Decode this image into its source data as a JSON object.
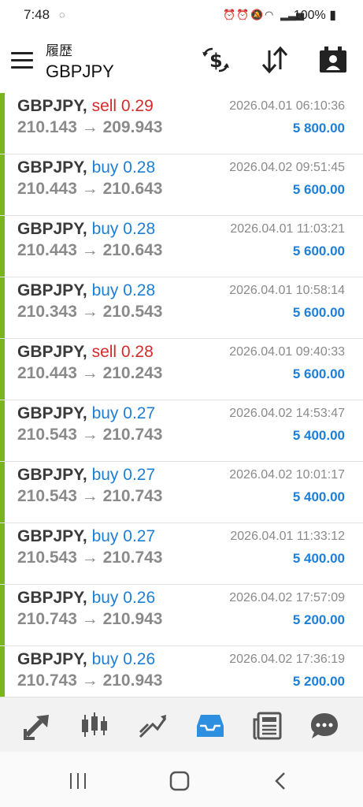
{
  "status_bar": {
    "time": "7:48",
    "battery": "100%"
  },
  "header": {
    "subtitle": "履歴",
    "symbol": "GBPJPY"
  },
  "trades": [
    {
      "symbol": "GBPJPY,",
      "side": "sell",
      "lots": "0.29",
      "prices": "210.143 → 209.943",
      "datetime": "2026.04.01 06:10:36",
      "profit": "5 800.00"
    },
    {
      "symbol": "GBPJPY,",
      "side": "buy",
      "lots": "0.28",
      "prices": "210.443 → 210.643",
      "datetime": "2026.04.02 09:51:45",
      "profit": "5 600.00"
    },
    {
      "symbol": "GBPJPY,",
      "side": "buy",
      "lots": "0.28",
      "prices": "210.443 → 210.643",
      "datetime": "2026.04.01 11:03:21",
      "profit": "5 600.00"
    },
    {
      "symbol": "GBPJPY,",
      "side": "buy",
      "lots": "0.28",
      "prices": "210.343 → 210.543",
      "datetime": "2026.04.01 10:58:14",
      "profit": "5 600.00"
    },
    {
      "symbol": "GBPJPY,",
      "side": "sell",
      "lots": "0.28",
      "prices": "210.443 → 210.243",
      "datetime": "2026.04.01 09:40:33",
      "profit": "5 600.00"
    },
    {
      "symbol": "GBPJPY,",
      "side": "buy",
      "lots": "0.27",
      "prices": "210.543 → 210.743",
      "datetime": "2026.04.02 14:53:47",
      "profit": "5 400.00"
    },
    {
      "symbol": "GBPJPY,",
      "side": "buy",
      "lots": "0.27",
      "prices": "210.543 → 210.743",
      "datetime": "2026.04.02 10:01:17",
      "profit": "5 400.00"
    },
    {
      "symbol": "GBPJPY,",
      "side": "buy",
      "lots": "0.27",
      "prices": "210.543 → 210.743",
      "datetime": "2026.04.01 11:33:12",
      "profit": "5 400.00"
    },
    {
      "symbol": "GBPJPY,",
      "side": "buy",
      "lots": "0.26",
      "prices": "210.743 → 210.943",
      "datetime": "2026.04.02 17:57:09",
      "profit": "5 200.00"
    },
    {
      "symbol": "GBPJPY,",
      "side": "buy",
      "lots": "0.26",
      "prices": "210.743 → 210.943",
      "datetime": "2026.04.02 17:36:19",
      "profit": "5 200.00"
    }
  ],
  "colors": {
    "buy": "#1e7fd6",
    "sell": "#d62a2a",
    "profit": "#1e7fd6",
    "accent_bar": "#7ab51d",
    "active_nav": "#2d8fe0"
  },
  "bottom_nav": [
    {
      "icon": "trade-icon",
      "active": false
    },
    {
      "icon": "candlestick-chart-icon",
      "active": false
    },
    {
      "icon": "trend-chart-icon",
      "active": false
    },
    {
      "icon": "history-inbox-icon",
      "active": true
    },
    {
      "icon": "news-icon",
      "active": false
    },
    {
      "icon": "chat-icon",
      "active": false
    }
  ]
}
